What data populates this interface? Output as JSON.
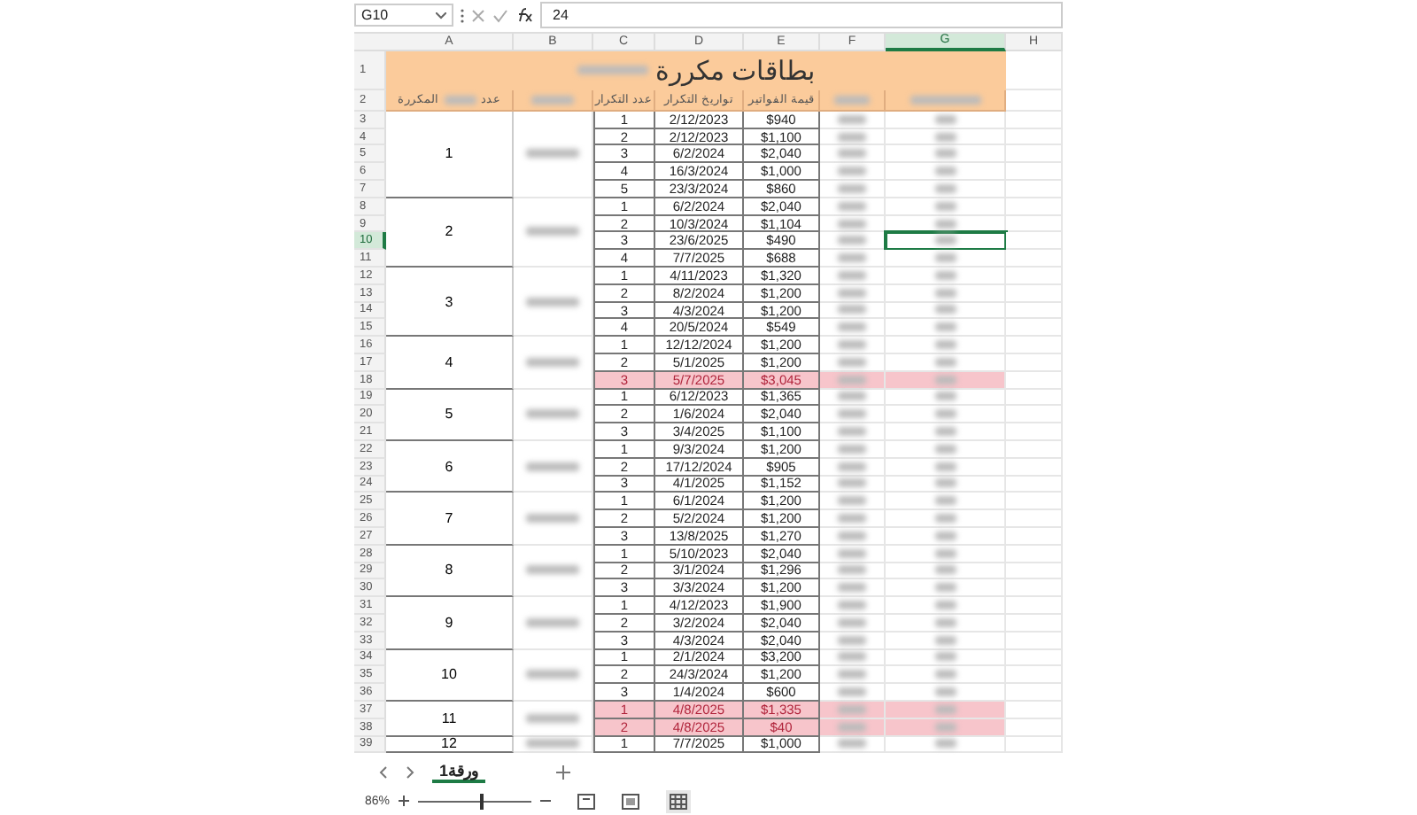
{
  "formula_bar": {
    "name_box": "G10",
    "value": "24"
  },
  "columns": [
    {
      "label": "A",
      "selected": false
    },
    {
      "label": "B",
      "selected": false
    },
    {
      "label": "C",
      "selected": false
    },
    {
      "label": "D",
      "selected": false
    },
    {
      "label": "E",
      "selected": false
    },
    {
      "label": "F",
      "selected": false
    },
    {
      "label": "G",
      "selected": true
    },
    {
      "label": "H",
      "selected": false
    }
  ],
  "row_numbers": [
    {
      "label": "1",
      "selected": false
    },
    {
      "label": "2",
      "selected": false
    },
    {
      "label": "3",
      "selected": false
    },
    {
      "label": "4",
      "selected": false
    },
    {
      "label": "5",
      "selected": false
    },
    {
      "label": "6",
      "selected": false
    },
    {
      "label": "7",
      "selected": false
    },
    {
      "label": "8",
      "selected": false
    },
    {
      "label": "9",
      "selected": false
    },
    {
      "label": "10",
      "selected": true
    },
    {
      "label": "11",
      "selected": false
    },
    {
      "label": "12",
      "selected": false
    },
    {
      "label": "13",
      "selected": false
    },
    {
      "label": "14",
      "selected": false
    },
    {
      "label": "15",
      "selected": false
    },
    {
      "label": "16",
      "selected": false
    },
    {
      "label": "17",
      "selected": false
    },
    {
      "label": "18",
      "selected": false
    },
    {
      "label": "19",
      "selected": false
    },
    {
      "label": "20",
      "selected": false
    },
    {
      "label": "21",
      "selected": false
    },
    {
      "label": "22",
      "selected": false
    },
    {
      "label": "23",
      "selected": false
    },
    {
      "label": "24",
      "selected": false
    },
    {
      "label": "25",
      "selected": false
    },
    {
      "label": "26",
      "selected": false
    },
    {
      "label": "27",
      "selected": false
    },
    {
      "label": "28",
      "selected": false
    },
    {
      "label": "29",
      "selected": false
    },
    {
      "label": "30",
      "selected": false
    },
    {
      "label": "31",
      "selected": false
    },
    {
      "label": "32",
      "selected": false
    },
    {
      "label": "33",
      "selected": false
    },
    {
      "label": "34",
      "selected": false
    },
    {
      "label": "35",
      "selected": false
    },
    {
      "label": "36",
      "selected": false
    },
    {
      "label": "37",
      "selected": false
    },
    {
      "label": "38",
      "selected": false
    },
    {
      "label": "39",
      "selected": false
    }
  ],
  "sheet": {
    "title": "بطاقات مكررة",
    "header_a": [
      "عدد",
      "المكررة"
    ],
    "header_c": "عدد التكرار",
    "header_d": "تواريخ التكرار",
    "header_e": "قيمة الفواتير",
    "groups": [
      {
        "label": "1",
        "entries": [
          {
            "n": "1",
            "date": "2/12/2023",
            "amount": "$940",
            "flagged": false
          },
          {
            "n": "2",
            "date": "2/12/2023",
            "amount": "$1,100",
            "flagged": false
          },
          {
            "n": "3",
            "date": "6/2/2024",
            "amount": "$2,040",
            "flagged": false
          },
          {
            "n": "4",
            "date": "16/3/2024",
            "amount": "$1,000",
            "flagged": false
          },
          {
            "n": "5",
            "date": "23/3/2024",
            "amount": "$860",
            "flagged": false
          }
        ]
      },
      {
        "label": "2",
        "entries": [
          {
            "n": "1",
            "date": "6/2/2024",
            "amount": "$2,040",
            "flagged": false
          },
          {
            "n": "2",
            "date": "10/3/2024",
            "amount": "$1,104",
            "flagged": false
          },
          {
            "n": "3",
            "date": "23/6/2025",
            "amount": "$490",
            "flagged": false
          },
          {
            "n": "4",
            "date": "7/7/2025",
            "amount": "$688",
            "flagged": false
          }
        ]
      },
      {
        "label": "3",
        "entries": [
          {
            "n": "1",
            "date": "4/11/2023",
            "amount": "$1,320",
            "flagged": false
          },
          {
            "n": "2",
            "date": "8/2/2024",
            "amount": "$1,200",
            "flagged": false
          },
          {
            "n": "3",
            "date": "4/3/2024",
            "amount": "$1,200",
            "flagged": false
          },
          {
            "n": "4",
            "date": "20/5/2024",
            "amount": "$549",
            "flagged": false
          }
        ]
      },
      {
        "label": "4",
        "entries": [
          {
            "n": "1",
            "date": "12/12/2024",
            "amount": "$1,200",
            "flagged": false
          },
          {
            "n": "2",
            "date": "5/1/2025",
            "amount": "$1,200",
            "flagged": false
          },
          {
            "n": "3",
            "date": "5/7/2025",
            "amount": "$3,045",
            "flagged": true
          }
        ]
      },
      {
        "label": "5",
        "entries": [
          {
            "n": "1",
            "date": "6/12/2023",
            "amount": "$1,365",
            "flagged": false
          },
          {
            "n": "2",
            "date": "1/6/2024",
            "amount": "$2,040",
            "flagged": false
          },
          {
            "n": "3",
            "date": "3/4/2025",
            "amount": "$1,100",
            "flagged": false
          }
        ]
      },
      {
        "label": "6",
        "entries": [
          {
            "n": "1",
            "date": "9/3/2024",
            "amount": "$1,200",
            "flagged": false
          },
          {
            "n": "2",
            "date": "17/12/2024",
            "amount": "$905",
            "flagged": false
          },
          {
            "n": "3",
            "date": "4/1/2025",
            "amount": "$1,152",
            "flagged": false
          }
        ]
      },
      {
        "label": "7",
        "entries": [
          {
            "n": "1",
            "date": "6/1/2024",
            "amount": "$1,200",
            "flagged": false
          },
          {
            "n": "2",
            "date": "5/2/2024",
            "amount": "$1,200",
            "flagged": false
          },
          {
            "n": "3",
            "date": "13/8/2025",
            "amount": "$1,270",
            "flagged": false
          }
        ]
      },
      {
        "label": "8",
        "entries": [
          {
            "n": "1",
            "date": "5/10/2023",
            "amount": "$2,040",
            "flagged": false
          },
          {
            "n": "2",
            "date": "3/1/2024",
            "amount": "$1,296",
            "flagged": false
          },
          {
            "n": "3",
            "date": "3/3/2024",
            "amount": "$1,200",
            "flagged": false
          }
        ]
      },
      {
        "label": "9",
        "entries": [
          {
            "n": "1",
            "date": "4/12/2023",
            "amount": "$1,900",
            "flagged": false
          },
          {
            "n": "2",
            "date": "3/2/2024",
            "amount": "$2,040",
            "flagged": false
          },
          {
            "n": "3",
            "date": "4/3/2024",
            "amount": "$2,040",
            "flagged": false
          }
        ]
      },
      {
        "label": "10",
        "entries": [
          {
            "n": "1",
            "date": "2/1/2024",
            "amount": "$3,200",
            "flagged": false
          },
          {
            "n": "2",
            "date": "24/3/2024",
            "amount": "$1,200",
            "flagged": false
          },
          {
            "n": "3",
            "date": "1/4/2024",
            "amount": "$600",
            "flagged": false
          }
        ]
      },
      {
        "label": "11",
        "entries": [
          {
            "n": "1",
            "date": "4/8/2025",
            "amount": "$1,335",
            "flagged": true
          },
          {
            "n": "2",
            "date": "4/8/2025",
            "amount": "$40",
            "flagged": true
          }
        ]
      },
      {
        "label": "12",
        "entries": [
          {
            "n": "1",
            "date": "7/7/2025",
            "amount": "$1,000",
            "flagged": false
          }
        ]
      }
    ]
  },
  "sheet_tabs": [
    {
      "label": "ورقة1",
      "selected": true
    }
  ],
  "status_bar": {
    "zoom": "86%",
    "level": 0.55
  }
}
